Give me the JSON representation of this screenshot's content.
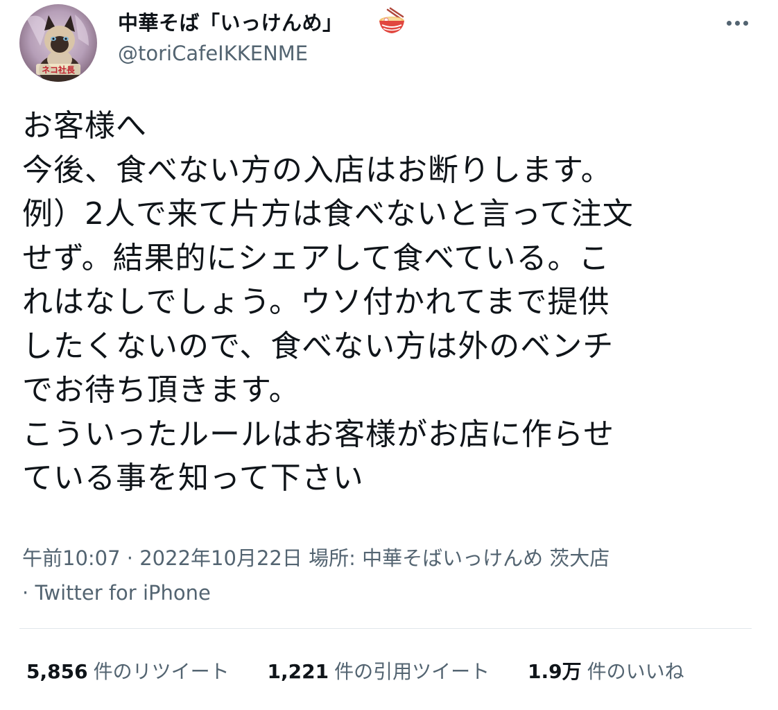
{
  "tweet": {
    "author": {
      "display_name": "中華そば「いっけんめ」",
      "name_emoji": "ramen-bowl-icon",
      "handle": "@toriCafeIKKENME",
      "avatar_caption": "ネコ社長"
    },
    "more_icon": "more-horizontal-icon",
    "text_lines": [
      "お客様へ",
      "今後、食べない方の入店はお断りします。",
      "例）2人で来て片方は食べないと言って注文",
      "せず。結果的にシェアして食べている。こ",
      "れはなしでしょう。ウソ付かれてまで提供",
      "したくないので、食べない方は外のベンチ",
      "でお待ち頂きます。",
      "こういったルールはお客様がお店に作らせ",
      "ている事を知って下さい"
    ],
    "meta": {
      "time": "午前10:07",
      "separator": " · ",
      "date": "2022年10月22日",
      "location_label": "場所: ",
      "location": "中華そばいっけんめ 茨大店",
      "source_prefix": "· ",
      "source": "Twitter for iPhone"
    },
    "stats": [
      {
        "count": "5,856",
        "label": "件のリツイート"
      },
      {
        "count": "1,221",
        "label": "件の引用ツイート"
      },
      {
        "count": "1.9万",
        "label": "件のいいね"
      }
    ]
  }
}
